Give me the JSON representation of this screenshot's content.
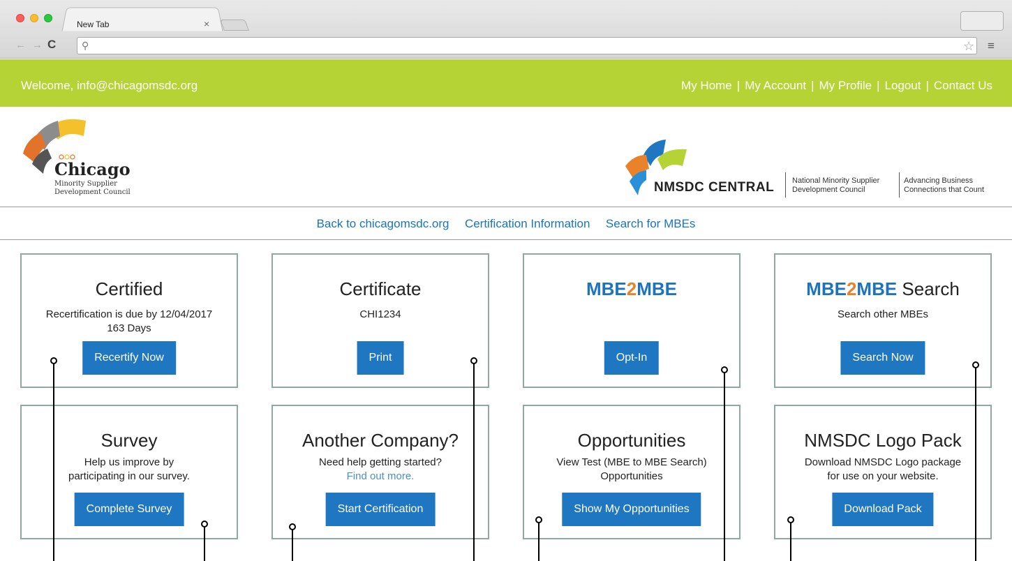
{
  "browser": {
    "tab_title": "New Tab",
    "tab_close": "×",
    "url": ""
  },
  "topbar": {
    "welcome": "Welcome, info@chicagomsdc.org",
    "links": [
      "My Home",
      "My Account",
      "My Profile",
      "Logout",
      "Contact Us"
    ],
    "separator": "|",
    "color": "#b5d334"
  },
  "header": {
    "chicago_logo": {
      "name": "Chicago",
      "line1": "Minority Supplier",
      "line2": "Development Council"
    },
    "nmsdc_logo": {
      "name": "NMSDC CENTRAL",
      "tag1": "National Minority Supplier Development Council",
      "tag2": "Advancing Business Connections that Count"
    }
  },
  "subnav": [
    "Back to chicagomsdc.org",
    "Certification Information",
    "Search for MBEs"
  ],
  "cards": {
    "certified": {
      "title": "Certified",
      "line1": "Recertification is due by 12/04/2017",
      "line2": "163 Days",
      "button": "Recertify Now"
    },
    "certificate": {
      "title": "Certificate",
      "line1": "CHI1234",
      "button": "Print"
    },
    "mbe2mbe": {
      "title_a": "MBE",
      "title_b": "2",
      "title_c": "MBE",
      "button": "Opt-In"
    },
    "mbe2mbe_search": {
      "title_a": "MBE",
      "title_b": "2",
      "title_c": "MBE",
      "title_d": " Search",
      "line1": "Search other MBEs",
      "button": "Search Now"
    },
    "survey": {
      "title": "Survey",
      "line1": "Help us improve by",
      "line2": "participating in our survey.",
      "button": "Complete Survey"
    },
    "another_company": {
      "title": "Another Company?",
      "line1": "Need help getting started?",
      "link": "Find out more.",
      "button": "Start Certification"
    },
    "opportunities": {
      "title": "Opportunities",
      "line1": "View Test (MBE to MBE Search)",
      "line2": "Opportunities",
      "button": "Show My Opportunities"
    },
    "logo_pack": {
      "title": "NMSDC Logo Pack",
      "line1": "Download NMSDC Logo package",
      "line2": "for use on your website.",
      "button": "Download Pack"
    }
  },
  "colors": {
    "accent_blue": "#1f77c1",
    "link_blue": "#1a74bb",
    "orange": "#e9822a",
    "card_border": "#8fa8a2"
  }
}
